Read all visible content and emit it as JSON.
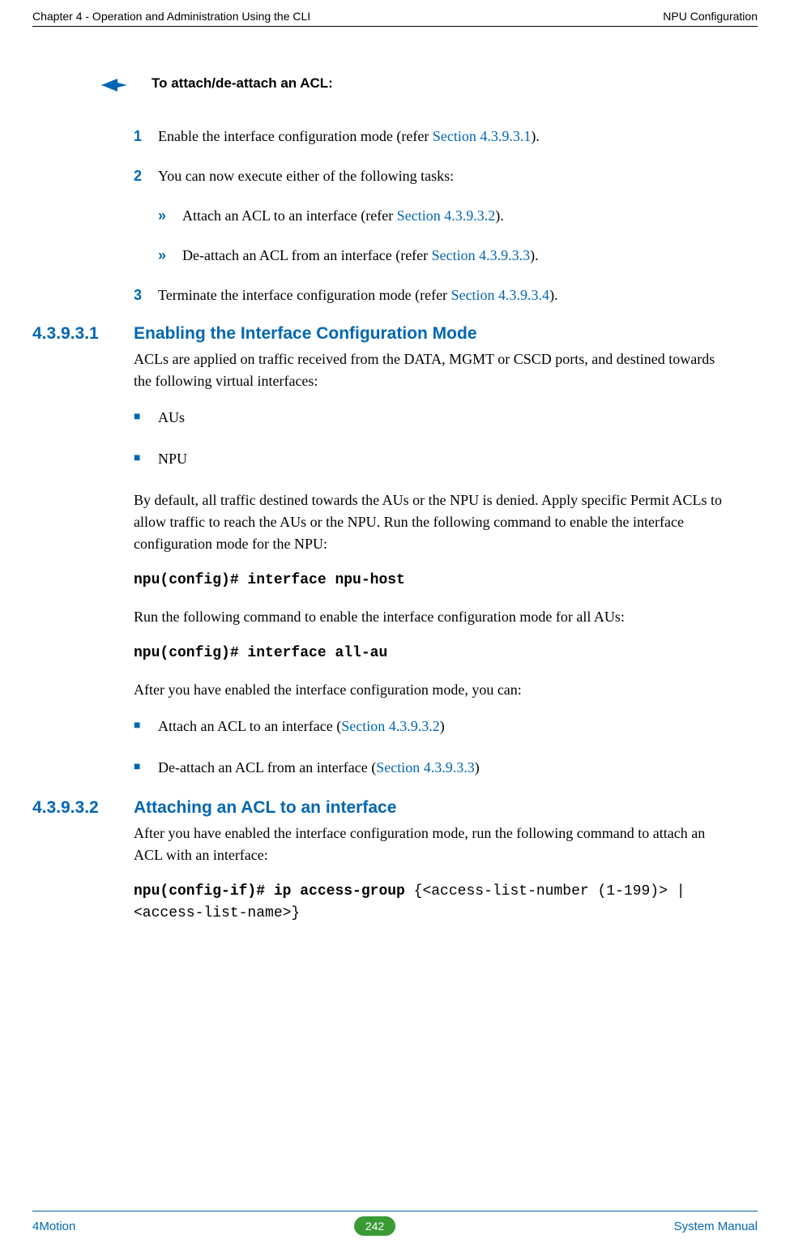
{
  "header": {
    "left": "Chapter 4 - Operation and Administration Using the CLI",
    "right": "NPU Configuration"
  },
  "callout": {
    "text": "To attach/de-attach an ACL:"
  },
  "steps": {
    "s1": {
      "num": "1",
      "pre": "Enable the interface configuration mode (refer ",
      "link": "Section 4.3.9.3.1",
      "post": ")."
    },
    "s2": {
      "num": "2",
      "text": "You can now execute either of the following tasks:"
    },
    "s2a": {
      "chev": "»",
      "pre": "Attach an ACL to an interface (refer ",
      "link": "Section 4.3.9.3.2",
      "post": ")."
    },
    "s2b": {
      "chev": "»",
      "pre": "De-attach an ACL from an interface (refer ",
      "link": "Section 4.3.9.3.3",
      "post": ")."
    },
    "s3": {
      "num": "3",
      "pre": "Terminate the interface configuration mode (refer ",
      "link": "Section 4.3.9.3.4",
      "post": ")."
    }
  },
  "sec1": {
    "num": "4.3.9.3.1",
    "title": "Enabling the Interface Configuration Mode",
    "p1": "ACLs are applied on traffic received from the DATA, MGMT or CSCD ports, and destined towards the following virtual interfaces:",
    "b1": "AUs",
    "b2": "NPU",
    "p2": "By default, all traffic destined towards the AUs or the NPU is denied. Apply specific Permit ACLs to allow traffic to reach the AUs or the NPU. Run the following command to enable the interface configuration mode for the NPU:",
    "code1": "npu(config)# interface npu-host",
    "p3": "Run the following command to enable the interface configuration mode for all AUs:",
    "code2": "npu(config)# interface all-au",
    "p4": "After you have enabled the interface configuration mode, you can:",
    "b3pre": "Attach an ACL to an interface (",
    "b3link": "Section 4.3.9.3.2",
    "b3post": ")",
    "b4pre": "De-attach an ACL from an interface (",
    "b4link": "Section 4.3.9.3.3",
    "b4post": ")"
  },
  "sec2": {
    "num": "4.3.9.3.2",
    "title": "Attaching an ACL to an interface",
    "p1": "After you have enabled the interface configuration mode, run the following command to attach an ACL with an interface:",
    "code_bold": "npu(config-if)# ip access-group ",
    "code_plain": "{<access-list-number (1-199)> | <access-list-name>}"
  },
  "footer": {
    "left": "4Motion",
    "page": "242",
    "right": "System Manual"
  },
  "glyph": {
    "square": "■"
  }
}
